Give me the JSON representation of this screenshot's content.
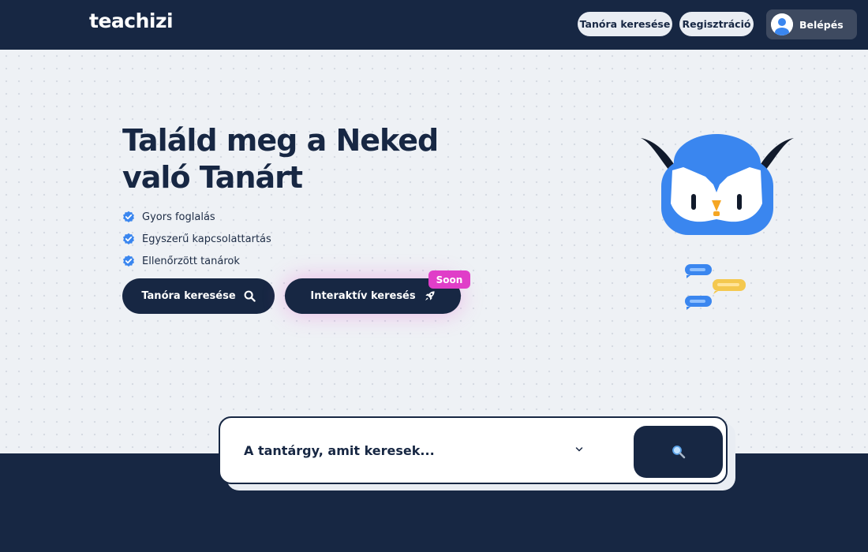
{
  "header": {
    "logo_text": "teachizi",
    "nav": {
      "search_label": "Tanóra keresése",
      "register_label": "Regisztráció",
      "login_label": "Belépés"
    }
  },
  "hero": {
    "headline_line1": "Találd meg a Neked",
    "headline_line2": "való Tanárt",
    "features": [
      "Gyors foglalás",
      "Egyszerű kapcsolattartás",
      "Ellenőrzött tanárok"
    ],
    "buttons": {
      "search_label": "Tanóra keresése",
      "interactive_label": "Interaktív keresés",
      "soon_badge": "Soon"
    }
  },
  "search": {
    "placeholder": "A tantárgy, amit keresek..."
  },
  "icons": {
    "check": "verified-check-icon",
    "search": "search-icon",
    "rocket": "rocket-icon",
    "avatar": "user-avatar-icon",
    "chevron": "chevron-down-icon",
    "mascot": "owl-mascot-icon"
  },
  "colors": {
    "navy": "#172743",
    "accent_blue": "#3a86ef",
    "badge_pink": "#e03ec8",
    "hero_bg": "#eef1f5",
    "bubble_yellow": "#f4c84f"
  }
}
